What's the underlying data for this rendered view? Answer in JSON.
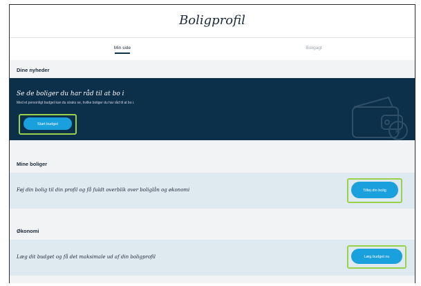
{
  "header": {
    "title": "Boligprofil",
    "tabs": [
      {
        "label": "Min side",
        "active": true
      },
      {
        "label": "Boligagt",
        "active": false
      }
    ]
  },
  "news": {
    "heading": "Dine nyheder",
    "title": "Se de boliger du har råd til at bo i",
    "description": "Med et personligt budget kan du straks se, hvilke boliger du har råd til at bo i.",
    "button_label": "Start budget",
    "icon": "wallet-icon",
    "icon_text": "kr"
  },
  "boliger": {
    "heading": "Mine boliger",
    "text": "Føj din bolig til din profil og få fuldt overblik over boliglån og økonomi",
    "button_label": "Tilføj din bolig"
  },
  "okonomi": {
    "heading": "Økonomi",
    "text": "Læg dit budget og få det maksimale ud af din boligprofil",
    "button_label": "Læg budget nu"
  },
  "colors": {
    "navy": "#0c2f4a",
    "accent_blue": "#1aa0dc",
    "highlight_green": "#9ad14b",
    "card_light": "#dfe9f0",
    "page_bg": "#f2f3f4"
  }
}
